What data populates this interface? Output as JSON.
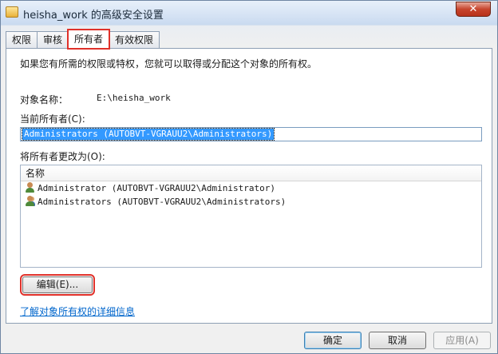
{
  "window": {
    "title": "heisha_work 的高级安全设置",
    "close_glyph": "✕"
  },
  "tabs": [
    {
      "label": "权限"
    },
    {
      "label": "审核"
    },
    {
      "label": "所有者"
    },
    {
      "label": "有效权限"
    }
  ],
  "owner_tab": {
    "description": "如果您有所需的权限或特权，您就可以取得或分配这个对象的所有权。",
    "object_name_label": "对象名称：",
    "object_name_value": "E:\\heisha_work",
    "current_owner_label": "当前所有者(C):",
    "current_owner_value": "Administrators (AUTOBVT-VGRAUU2\\Administrators)",
    "change_owner_label": "将所有者更改为(O):",
    "list_header": "名称",
    "list_items": [
      {
        "name": "Administrator (AUTOBVT-VGRAUU2\\Administrator)",
        "icon": "user-icon"
      },
      {
        "name": "Administrators (AUTOBVT-VGRAUU2\\Administrators)",
        "icon": "group-icon"
      }
    ],
    "edit_button": "编辑(E)...",
    "learn_more_link": "了解对象所有权的详细信息"
  },
  "footer": {
    "ok": "确定",
    "cancel": "取消",
    "apply": "应用(A)"
  },
  "colors": {
    "highlight": "#e0312a",
    "selection": "#3399ff",
    "link": "#0066cc"
  }
}
